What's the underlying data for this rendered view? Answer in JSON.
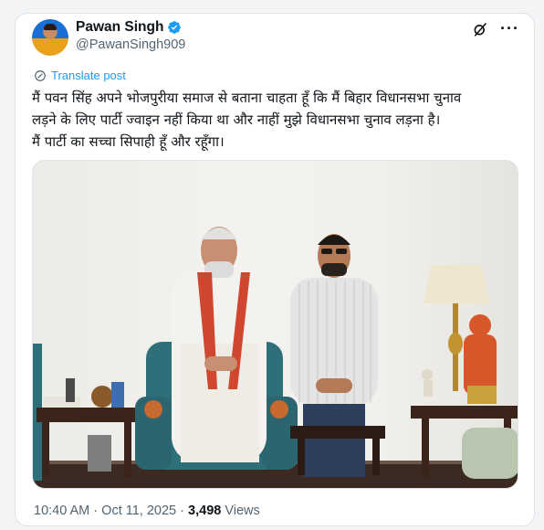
{
  "post": {
    "author": {
      "name": "Pawan Singh",
      "handle": "@PawanSingh909",
      "verified": true
    },
    "translate_label": "Translate post",
    "text_lines": [
      "मैं पवन सिंह अपने भोजपुरीया समाज से बताना चाहता हूँ कि मैं बिहार विधानसभा चुनाव",
      "लड़ने के लिए पार्टी ज्वाइन नहीं किया था और नाहीं मुझे विधानसभा चुनाव लड़ना है।",
      "मैं पार्टी का सच्चा सिपाही हूँ और रहूँगा।"
    ],
    "time": "10:40 AM",
    "date": "Oct 11, 2025",
    "separator": "·",
    "views_count": "3,498",
    "views_label": "Views"
  },
  "icons": {
    "verified": "verified-badge-icon",
    "grok": "grok-icon",
    "more": "more-icon",
    "translate": "translate-icon"
  },
  "colors": {
    "accent": "#1d9bf0",
    "text": "#0f1419",
    "muted": "#536471",
    "border": "#dfe3e6"
  }
}
